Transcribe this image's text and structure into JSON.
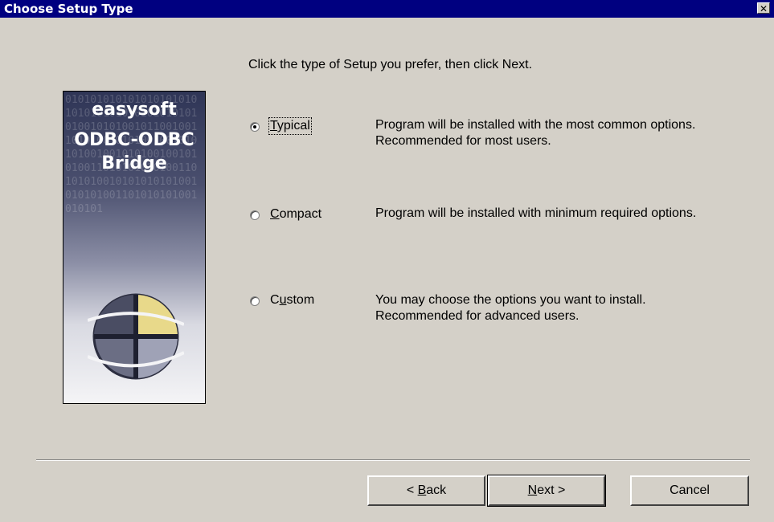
{
  "window": {
    "title": "Choose Setup Type",
    "close_glyph": "✕"
  },
  "instruction": "Click the type of Setup you prefer, then click Next.",
  "banner": {
    "line1": "easysoft",
    "line2": "ODBC-ODBC",
    "line3": "Bridge",
    "binary": "010101010101010101010101010101010101010101010010101001011001001101010010101001001010101001001010100100101010011010101010100110101010010101010101001010101001101010101001010101"
  },
  "options": [
    {
      "accel": "T",
      "rest": "ypical",
      "selected": true,
      "description": "Program will be installed with the most common options.  Recommended for most users."
    },
    {
      "accel": "C",
      "rest": "ompact",
      "selected": false,
      "description": "Program will be installed with minimum required options."
    },
    {
      "pre": "C",
      "accel": "u",
      "rest": "stom",
      "selected": false,
      "description": "You may choose the options you want to install. Recommended for advanced users."
    }
  ],
  "buttons": {
    "back": {
      "prefix": "< ",
      "accel": "B",
      "rest": "ack"
    },
    "next": {
      "accel": "N",
      "rest": "ext",
      "suffix": " >"
    },
    "cancel": "Cancel"
  }
}
